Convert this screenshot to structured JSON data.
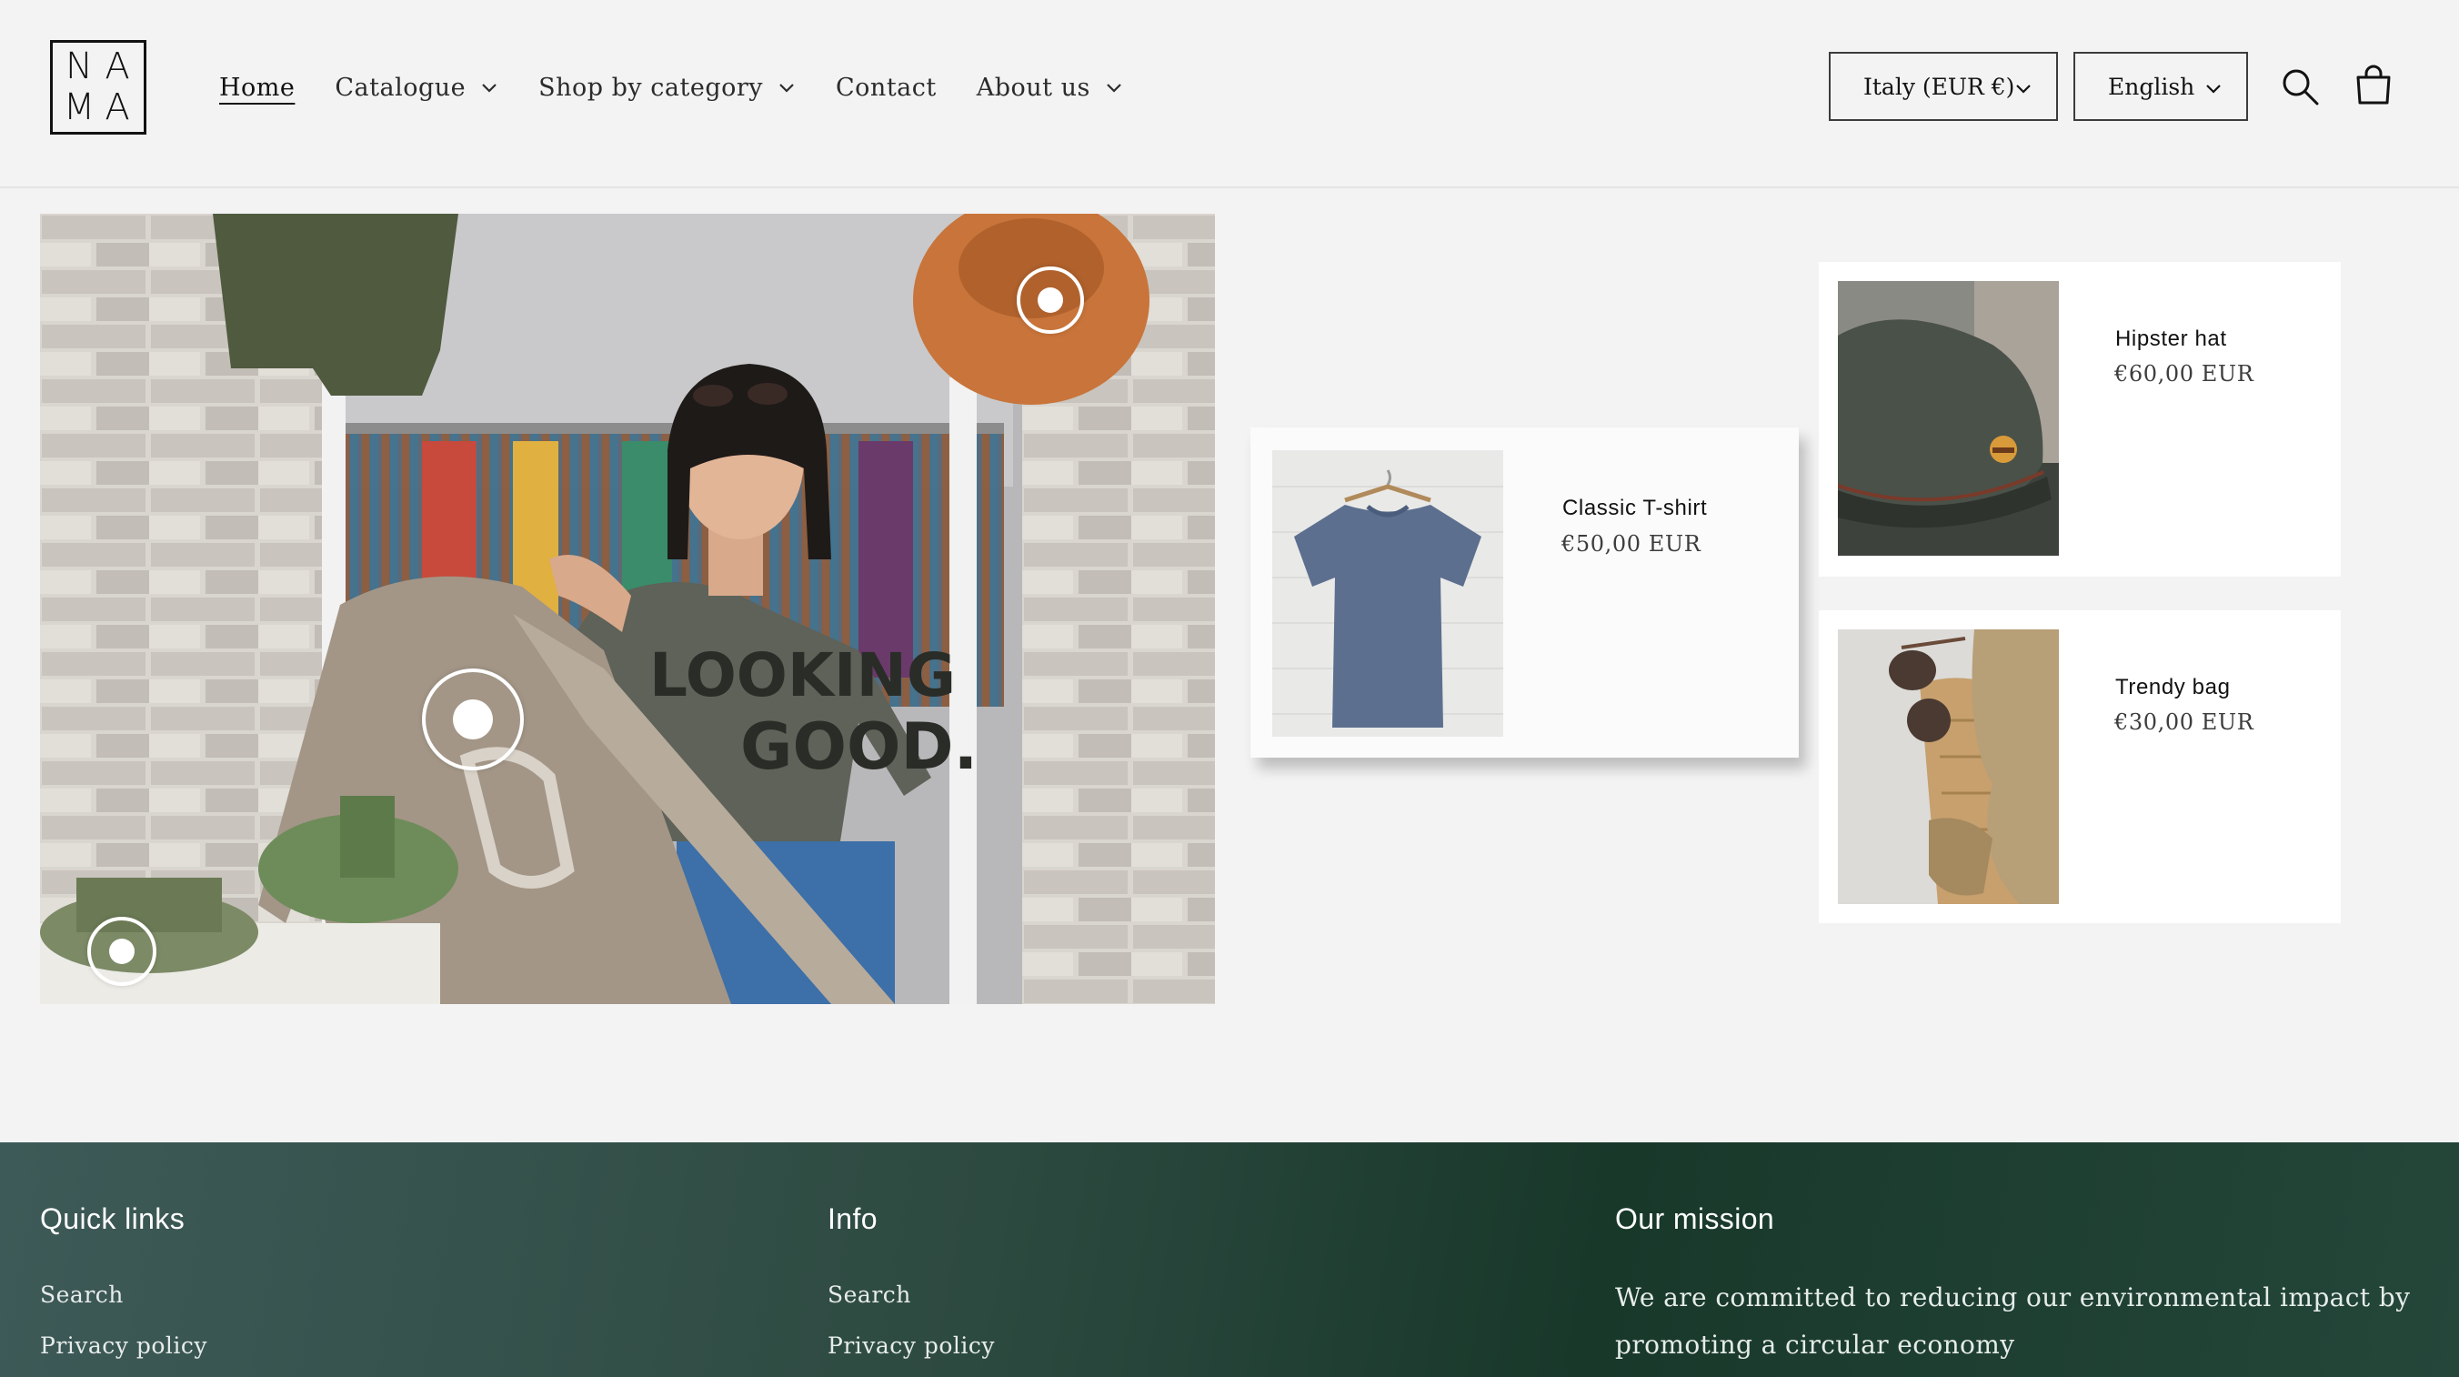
{
  "brand": {
    "logo_letters": [
      "N",
      "A",
      "M",
      "A"
    ]
  },
  "nav": {
    "items": [
      {
        "label": "Home",
        "active": true,
        "has_dropdown": false
      },
      {
        "label": "Catalogue",
        "has_dropdown": true
      },
      {
        "label": "Shop by category",
        "has_dropdown": true
      },
      {
        "label": "Contact",
        "has_dropdown": false
      },
      {
        "label": "About us",
        "has_dropdown": true
      }
    ]
  },
  "localization": {
    "country": "Italy (EUR €)",
    "language": "English"
  },
  "header_icons": [
    "search-icon",
    "cart-icon"
  ],
  "lookbook": {
    "shirt_text_line1": "LOOKING",
    "shirt_text_line2": "GOOD.",
    "hotspots": 3
  },
  "products": [
    {
      "name": "Classic T-shirt",
      "price": "€50,00 EUR",
      "featured": true
    },
    {
      "name": "Hipster hat",
      "price": "€60,00 EUR"
    },
    {
      "name": "Trendy bag",
      "price": "€30,00 EUR"
    }
  ],
  "footer": {
    "quick_links": {
      "heading": "Quick links",
      "links": [
        "Search",
        "Privacy policy"
      ]
    },
    "info": {
      "heading": "Info",
      "links": [
        "Search",
        "Privacy policy"
      ]
    },
    "mission": {
      "heading": "Our mission",
      "text": "We are committed to reducing our environmental impact by promoting a circular economy"
    }
  },
  "colors": {
    "background": "#f3f3f3",
    "footer_start": "#3e5a58",
    "footer_end": "#18382a",
    "text": "#121212"
  }
}
